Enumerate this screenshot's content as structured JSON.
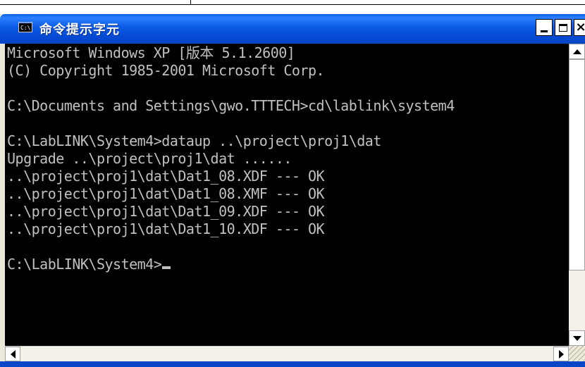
{
  "window": {
    "title": "命令提示字元",
    "icon": "cmd-icon",
    "icon_text": "C:\\"
  },
  "colors": {
    "titlebar": "#0a5fe0",
    "console_bg": "#000000",
    "console_fg": "#c0c0c0"
  },
  "console": {
    "lines": [
      "Microsoft Windows XP [版本 5.1.2600]",
      "(C) Copyright 1985-2001 Microsoft Corp.",
      "",
      "C:\\Documents and Settings\\gwo.TTTECH>cd\\lablink\\system4",
      "",
      "C:\\LabLINK\\System4>dataup ..\\project\\proj1\\dat",
      "Upgrade ..\\project\\proj1\\dat ......",
      "..\\project\\proj1\\dat\\Dat1_08.XDF --- OK",
      "..\\project\\proj1\\dat\\Dat1_08.XMF --- OK",
      "..\\project\\proj1\\dat\\Dat1_09.XDF --- OK",
      "..\\project\\proj1\\dat\\Dat1_10.XDF --- OK",
      "",
      "C:\\LabLINK\\System4>"
    ]
  }
}
